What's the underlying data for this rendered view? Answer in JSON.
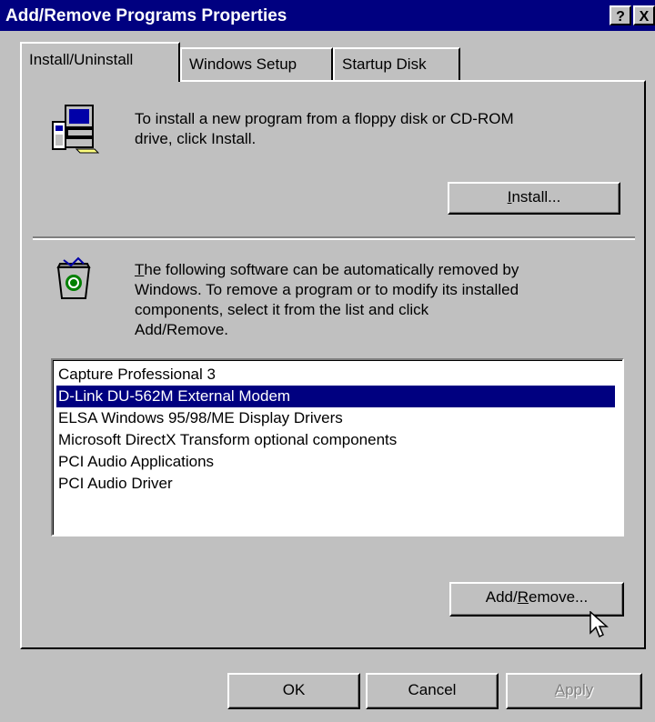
{
  "window": {
    "title": "Add/Remove Programs Properties"
  },
  "titlebar": {
    "help_label": "?",
    "close_label": "X"
  },
  "tabs": [
    {
      "label": "Install/Uninstall",
      "active": true
    },
    {
      "label": "Windows Setup",
      "active": false
    },
    {
      "label": "Startup Disk",
      "active": false
    }
  ],
  "install_section": {
    "text_line1": "To install a new program from a floppy disk or CD-ROM",
    "text_line2": "drive, click Install.",
    "button_pre": "",
    "button_accel": "I",
    "button_post": "nstall..."
  },
  "remove_section": {
    "text_line1_accel": "T",
    "text_line1_rest": "he following software can be automatically removed by",
    "text_line2": "Windows. To remove a program or to modify its installed",
    "text_line3": "components, select it from the list and click",
    "text_line4": "Add/Remove."
  },
  "programs": [
    {
      "label": "Capture Professional 3",
      "selected": false
    },
    {
      "label": "D-Link DU-562M External Modem",
      "selected": true
    },
    {
      "label": "ELSA Windows 95/98/ME Display Drivers",
      "selected": false
    },
    {
      "label": "Microsoft DirectX Transform optional components",
      "selected": false
    },
    {
      "label": "PCI Audio Applications",
      "selected": false
    },
    {
      "label": "PCI Audio Driver",
      "selected": false
    }
  ],
  "add_remove_button": {
    "pre": "Add/",
    "accel": "R",
    "post": "emove..."
  },
  "footer": {
    "ok_label": "OK",
    "cancel_label": "Cancel",
    "apply_accel": "A",
    "apply_rest": "pply"
  },
  "colors": {
    "selection": "#000080",
    "titlebar": "#000080",
    "face": "#c0c0c0"
  },
  "icons": [
    "computer-install-icon",
    "recycle-bin-icon",
    "mouse-pointer-icon"
  ]
}
